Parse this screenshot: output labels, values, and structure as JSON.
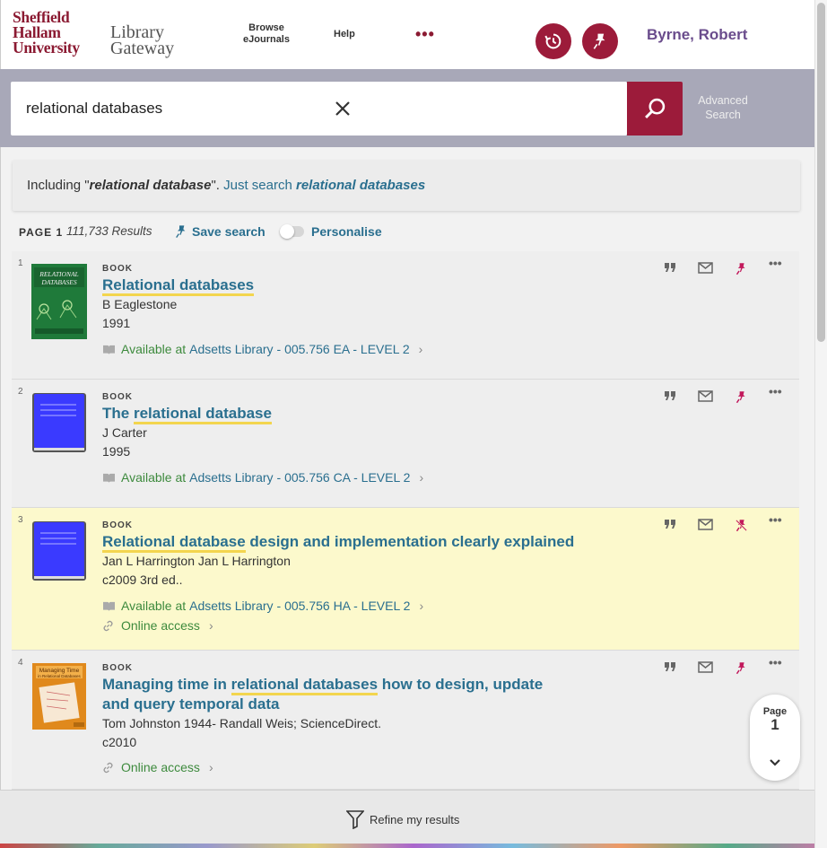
{
  "header": {
    "logo_line1": "Sheffield",
    "logo_line2": "Hallam",
    "logo_line3": "University",
    "logo_sub1": "Library",
    "logo_sub2": "Gateway",
    "nav_browse_1": "Browse",
    "nav_browse_2": "eJournals",
    "nav_help": "Help",
    "nav_more": "•••",
    "user_name": "Byrne, Robert",
    "accent": "#9c1b3a"
  },
  "search": {
    "query": "relational databases",
    "advanced_1": "Advanced",
    "advanced_2": "Search"
  },
  "including": {
    "prefix": "Including \"",
    "term": "relational database",
    "suffix": "\". ",
    "just_search": "Just search ",
    "just_term": "relational databases"
  },
  "results_bar": {
    "page_label": "PAGE 1",
    "count": "111,733 Results",
    "save_search": "Save search",
    "personalise": "Personalise"
  },
  "results": [
    {
      "num": "1",
      "type": "BOOK",
      "title_mark": "Relational databases",
      "title_rest": "",
      "author": "B Eaglestone",
      "date": "1991",
      "avail_label": "Available at",
      "library": "Adsetts Library",
      "callno": " - 005.756 EA - LEVEL 2",
      "cover_text": "RELATIONAL DATABASES"
    },
    {
      "num": "2",
      "type": "BOOK",
      "title_pre": "The ",
      "title_mark": "relational database",
      "author": "J Carter",
      "date": "1995",
      "avail_label": "Available at",
      "library": "Adsetts Library",
      "callno": " - 005.756 CA - LEVEL 2"
    },
    {
      "num": "3",
      "type": "BOOK",
      "title_mark": "Relational database",
      "title_rest": " design and implementation clearly explained",
      "author": "Jan L Harrington Jan L Harrington",
      "date": "c2009 3rd ed..",
      "avail_label": "Available at",
      "library": "Adsetts Library",
      "callno": " - 005.756 HA - LEVEL 2",
      "online": "Online access"
    },
    {
      "num": "4",
      "type": "BOOK",
      "title_pre": "Managing time in ",
      "title_mark": "relational databases",
      "title_rest": " how to design, update and query temporal data",
      "author": "Tom Johnston 1944- Randall Weis; ScienceDirect.",
      "date": "c2010",
      "online": "Online access",
      "cover_text": "Managing Time in Relational Databases"
    }
  ],
  "page_indicator": {
    "label": "Page",
    "number": "1"
  },
  "refine": {
    "label": "Refine my results"
  }
}
